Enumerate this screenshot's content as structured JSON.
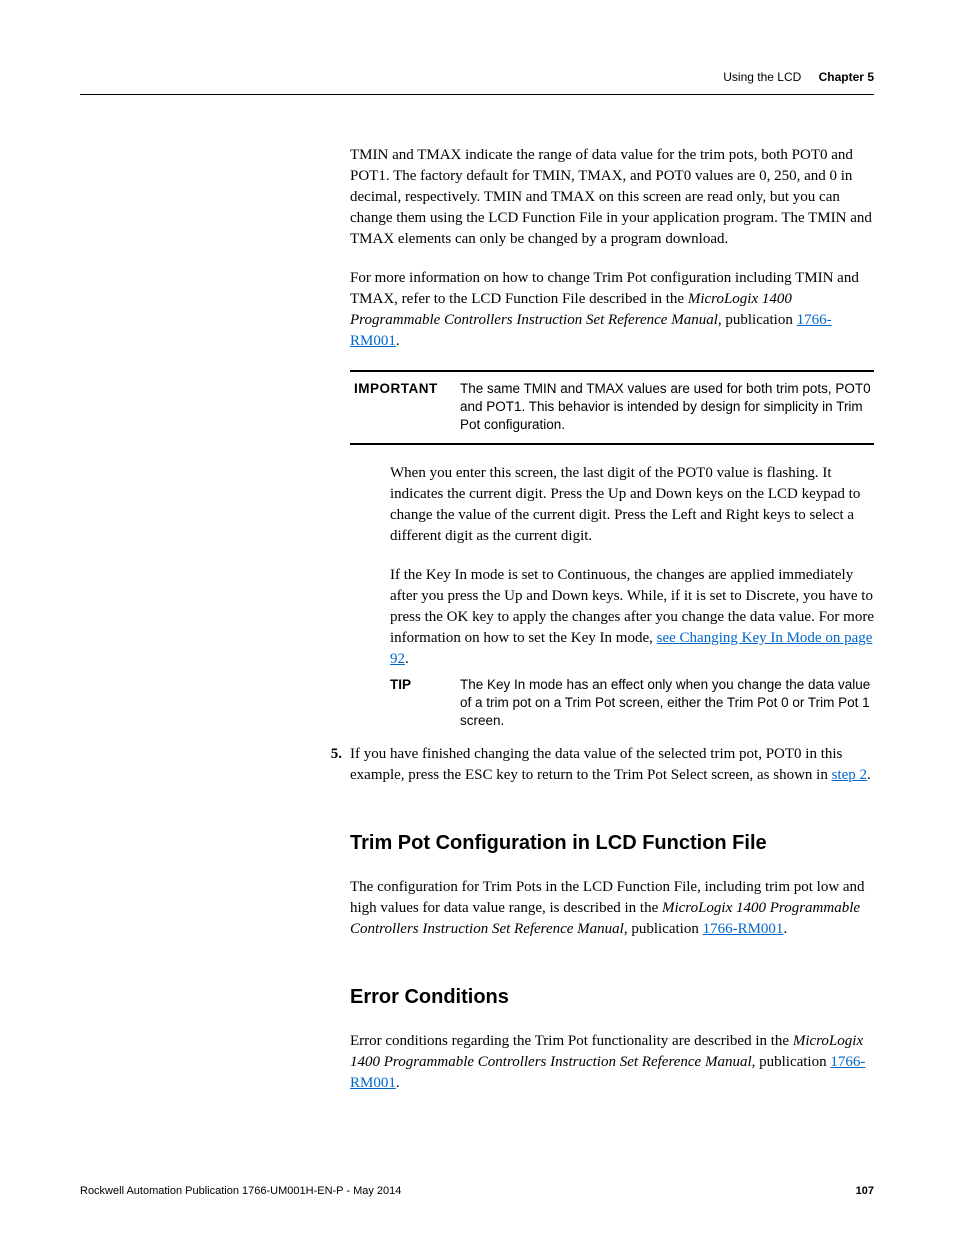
{
  "header": {
    "section": "Using the LCD",
    "chapter": "Chapter 5"
  },
  "body": {
    "p1": "TMIN and TMAX indicate the range of data value for the trim pots, both POT0 and POT1. The factory default for TMIN, TMAX, and POT0 values are 0, 250, and 0 in decimal, respectively. TMIN and TMAX on this screen are read only, but you can change them using the LCD Function File in your application program. The TMIN and TMAX elements can only be changed by a program download.",
    "p2_a": "For more information on how to change Trim Pot configuration including TMIN and TMAX, refer to the LCD Function File described in the ",
    "p2_i": "MicroLogix 1400 Programmable Controllers Instruction Set Reference Manual",
    "p2_b": ", publication ",
    "p2_link": "1766-RM001",
    "p2_c": ".",
    "important_label": "IMPORTANT",
    "important_body": "The same TMIN and TMAX values are used for both trim pots, POT0 and POT1. This behavior is intended by design for simplicity in Trim Pot configuration.",
    "p3": "When you enter this screen, the last digit of the POT0 value is flashing. It indicates the current digit. Press the Up and Down keys on the LCD keypad to change the value of the current digit. Press the Left and Right keys to select a different digit as the current digit.",
    "p4_a": "If the Key In mode is set to Continuous, the changes are applied immediately after you press the Up and Down keys. While, if it is set to Discrete, you have to press the OK key to apply the changes after you change the data value. For more information on how to set the Key In mode, ",
    "p4_link": "see  Changing Key In Mode on page 92",
    "p4_b": ".",
    "tip_label": "TIP",
    "tip_body": "The Key In mode has an effect only when you change the data value of a trim pot on a Trim Pot screen, either the Trim Pot 0 or Trim Pot 1 screen.",
    "step5_num": "5.",
    "step5_a": "If you have finished changing the data value of the selected trim pot, POT0 in this example, press the ESC key to return to the Trim Pot Select screen, as shown in ",
    "step5_link": "step 2",
    "step5_b": "."
  },
  "section2": {
    "heading": "Trim Pot Configuration in LCD Function File",
    "p_a": "The configuration for Trim Pots in the LCD Function File, including trim pot low and high values for data value range, is described in the ",
    "p_i": "MicroLogix 1400 Programmable Controllers Instruction Set Reference Manual",
    "p_b": ", publication ",
    "p_link": "1766-RM001",
    "p_c": "."
  },
  "section3": {
    "heading": "Error Conditions",
    "p_a": "Error conditions regarding the Trim Pot functionality are described in the ",
    "p_i": "MicroLogix 1400 Programmable Controllers Instruction Set Reference Manual",
    "p_b": ", publication ",
    "p_link": "1766-RM001",
    "p_c": "."
  },
  "footer": {
    "pub": "Rockwell Automation Publication 1766-UM001H-EN-P - May 2014",
    "page": "107"
  }
}
